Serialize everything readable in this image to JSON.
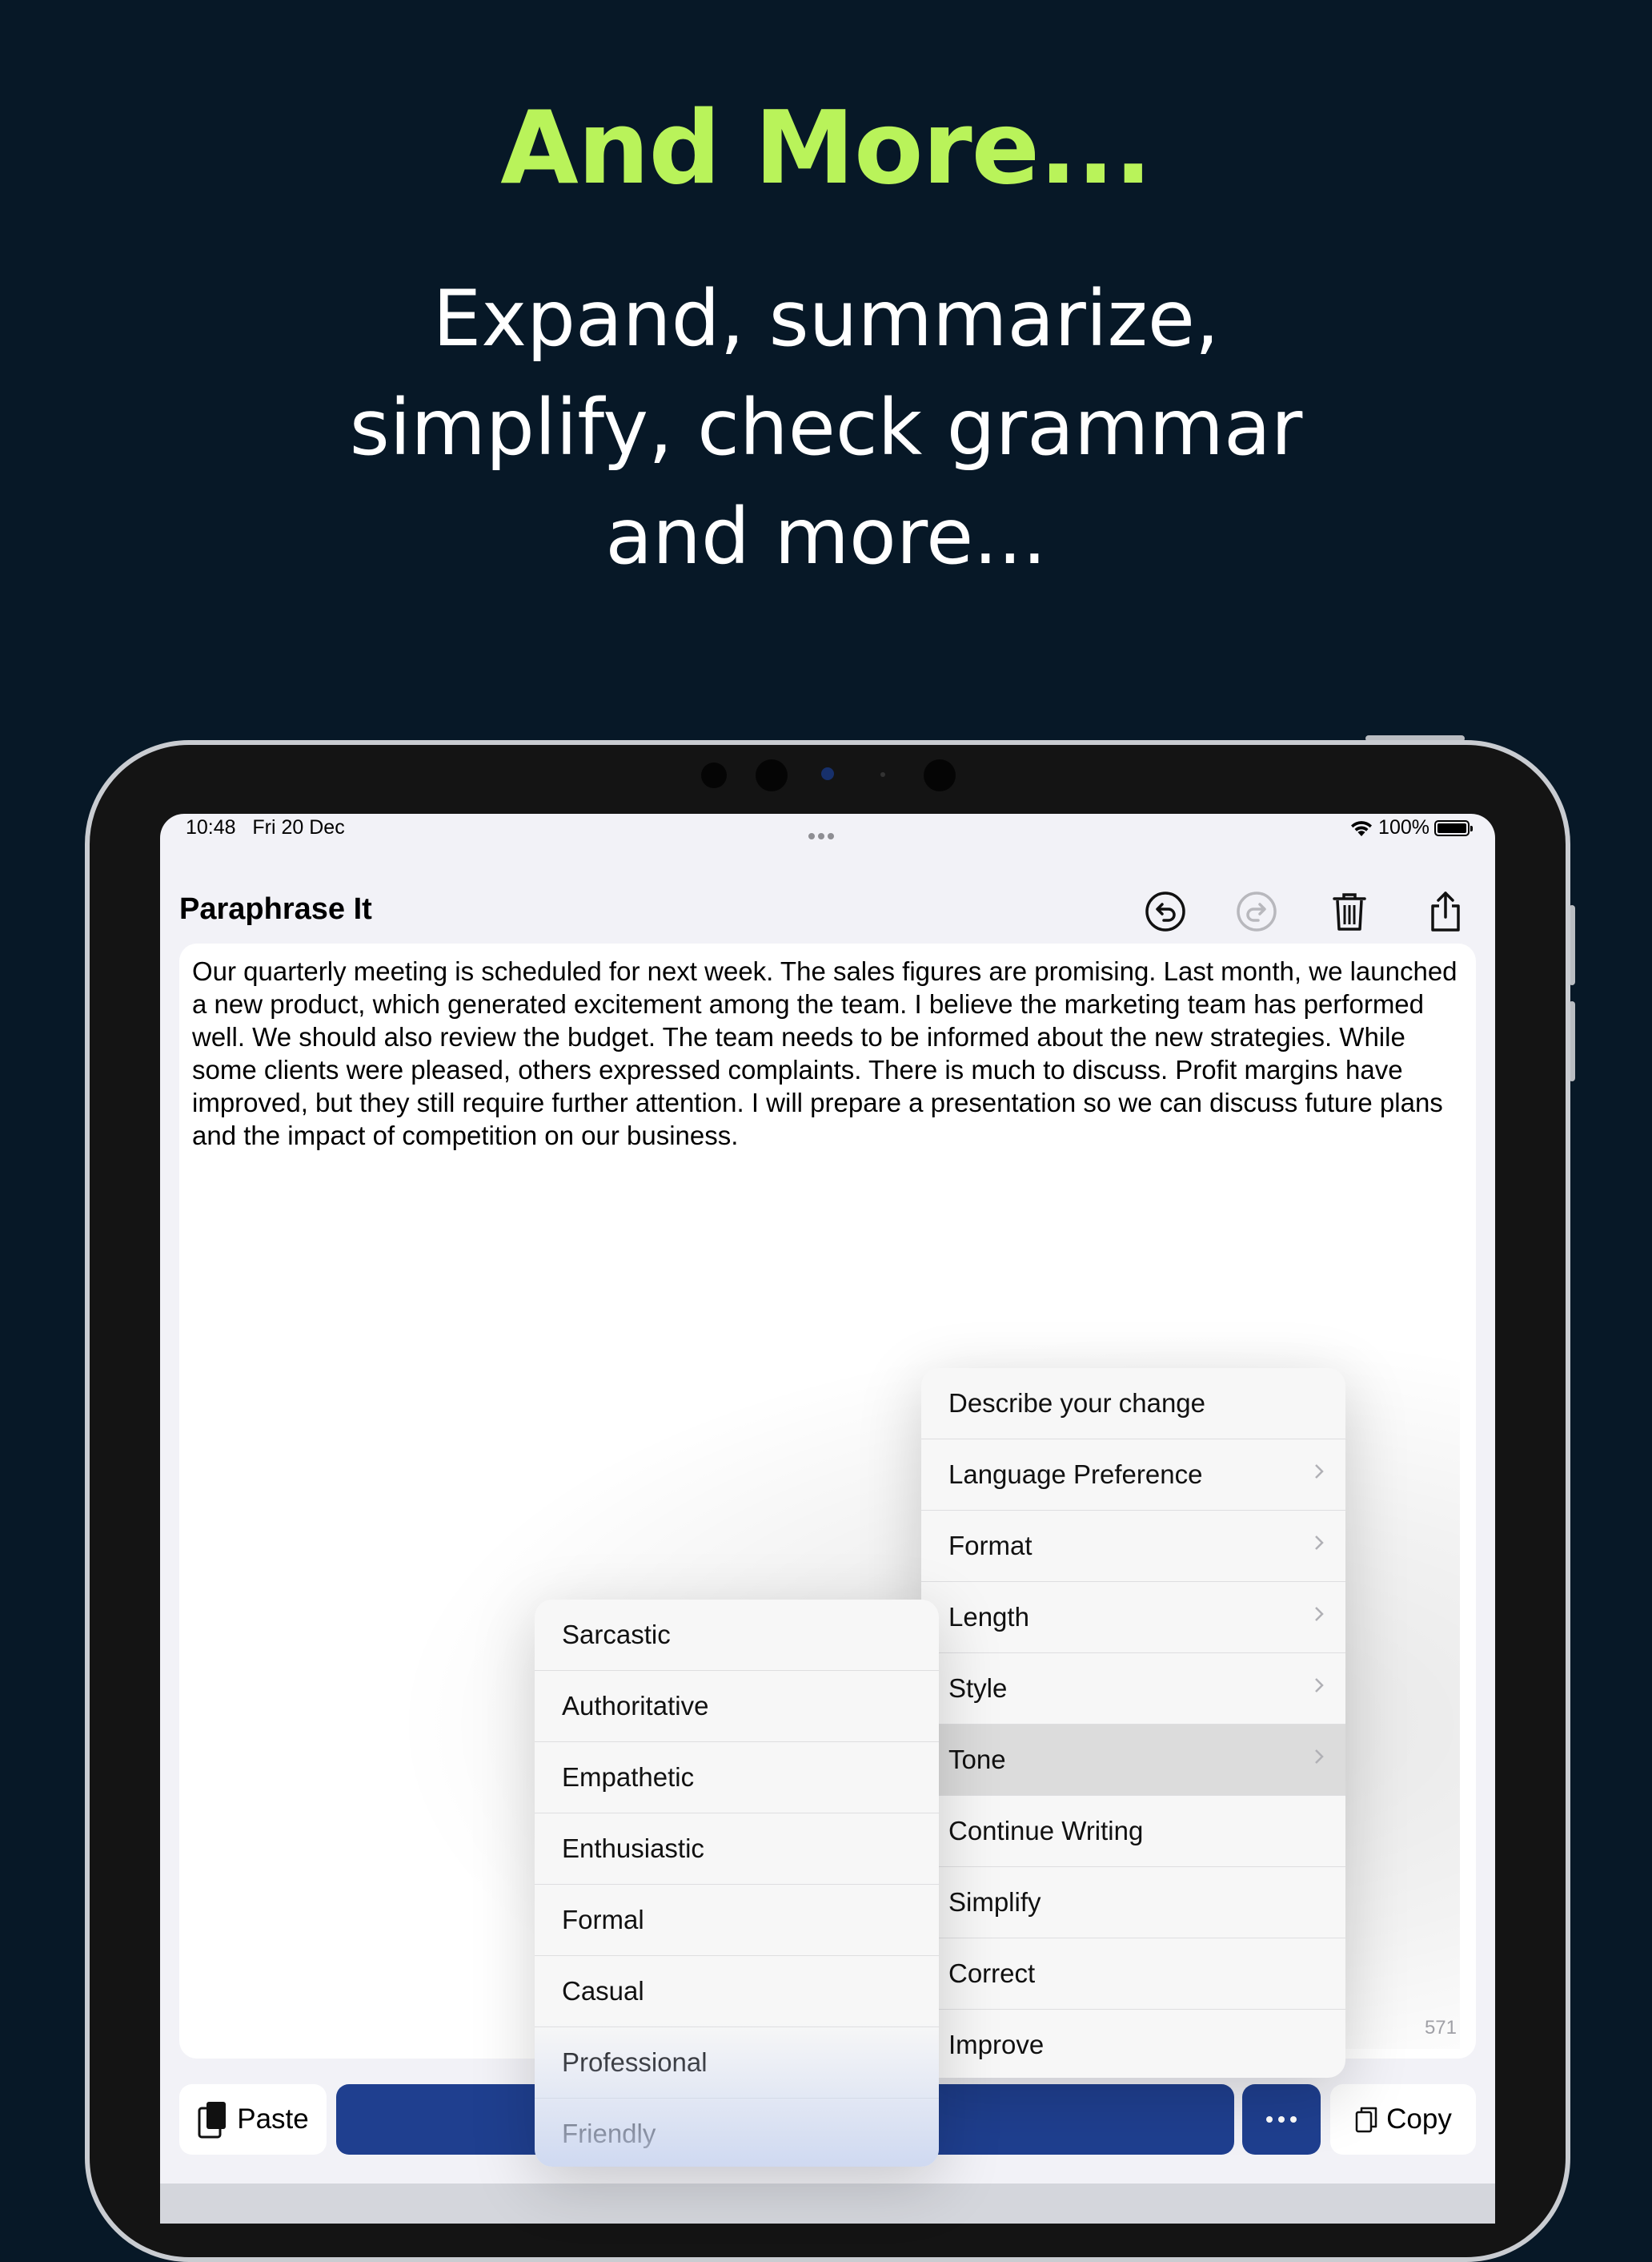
{
  "headline": "And More...",
  "subheadline": {
    "line1": "Expand, summarize,",
    "line2": "simplify, check grammar",
    "line3": "and more..."
  },
  "status_bar": {
    "time": "10:48",
    "date": "Fri 20 Dec",
    "battery": "100%"
  },
  "app": {
    "title": "Paraphrase It",
    "toolbar_icons": [
      "undo-icon",
      "redo-icon",
      "trash-icon",
      "share-icon"
    ]
  },
  "editor": {
    "text": "Our quarterly meeting is scheduled for next week. The sales figures are promising. Last month, we launched a new product, which generated excitement among the team. I believe the marketing team has performed well. We should also review the budget. The team needs to be informed about the new strategies. While some clients were pleased, others expressed complaints. There is much to discuss. Profit margins have improved, but they still require further attention. I will prepare a presentation so we can discuss future plans and the impact of competition on our business.",
    "char_count": "571"
  },
  "bottom_bar": {
    "paste_label": "Paste",
    "copy_label": "Copy"
  },
  "menu": {
    "items": [
      {
        "label": "Describe your change",
        "submenu": false
      },
      {
        "label": "Language Preference",
        "submenu": true
      },
      {
        "label": "Format",
        "submenu": true
      },
      {
        "label": "Length",
        "submenu": true
      },
      {
        "label": "Style",
        "submenu": true
      },
      {
        "label": "Tone",
        "submenu": true
      },
      {
        "label": "Continue Writing",
        "submenu": false
      },
      {
        "label": "Simplify",
        "submenu": false
      },
      {
        "label": "Correct",
        "submenu": false
      },
      {
        "label": "Improve",
        "submenu": false
      }
    ],
    "active": "Tone"
  },
  "tone_menu": {
    "items": [
      "Sarcastic",
      "Authoritative",
      "Empathetic",
      "Enthusiastic",
      "Formal",
      "Casual",
      "Professional",
      "Friendly"
    ]
  },
  "colors": {
    "background": "#071827",
    "headline": "#b9f35a",
    "primary_button": "#1f3f8f"
  }
}
